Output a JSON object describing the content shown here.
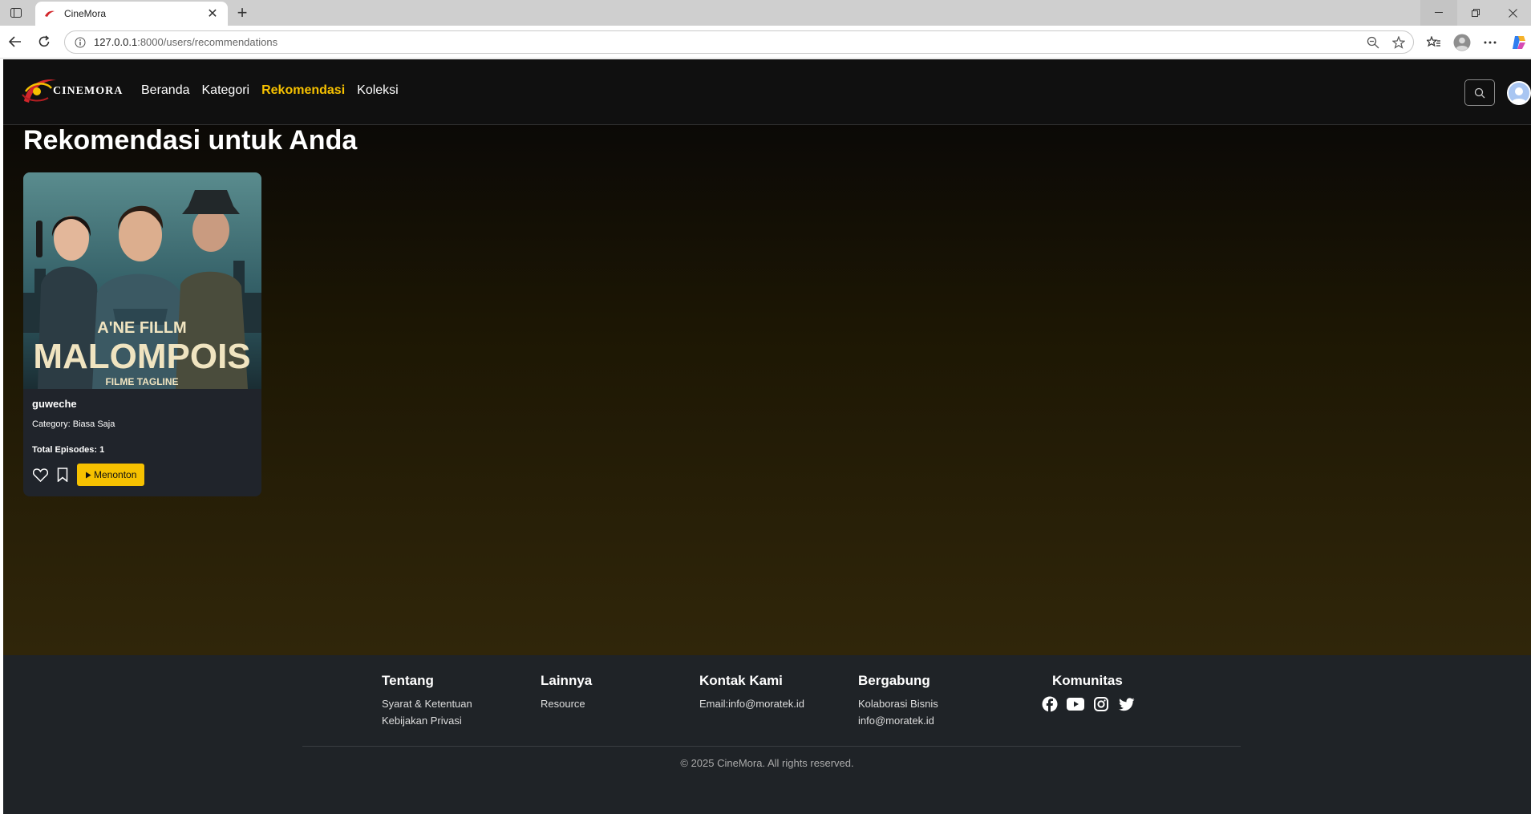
{
  "browser": {
    "tab_title": "CineMora",
    "url_host": "127.0.0.1",
    "url_rest": ":8000/users/recommendations"
  },
  "site": {
    "logo_text": "CINEMORA",
    "nav": [
      "Beranda",
      "Kategori",
      "Rekomendasi",
      "Koleksi"
    ],
    "active_nav": "Rekomendasi",
    "accent_color": "#f6c100"
  },
  "main": {
    "title": "Rekomendasi untuk Anda",
    "cards": [
      {
        "poster_line1": "A'NE FILLM",
        "poster_line2": "MALOMPOIS",
        "poster_tagline": "FILME TAGLINE",
        "title": "guweche",
        "category": "Category: Biasa Saja",
        "episodes": "Total Episodes: 1",
        "watch_label": "Menonton"
      }
    ]
  },
  "footer": {
    "about": {
      "heading": "Tentang",
      "links": [
        "Syarat & Ketentuan",
        "Kebijakan Privasi"
      ]
    },
    "more": {
      "heading": "Lainnya",
      "links": [
        "Resource"
      ]
    },
    "contact": {
      "heading": "Kontak Kami",
      "links": [
        "Email:info@moratek.id"
      ]
    },
    "join": {
      "heading": "Bergabung",
      "links": [
        "Kolaborasi Bisnis",
        "info@moratek.id"
      ]
    },
    "community": {
      "heading": "Komunitas",
      "icons": [
        "facebook-icon",
        "youtube-icon",
        "instagram-icon",
        "twitter-icon"
      ]
    },
    "copyright": "© 2025 CineMora. All rights reserved."
  }
}
